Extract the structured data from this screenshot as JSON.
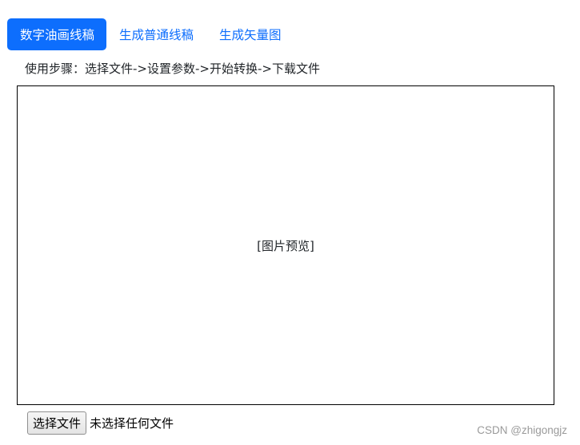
{
  "tabs": [
    {
      "label": "数字油画线稿",
      "active": true
    },
    {
      "label": "生成普通线稿",
      "active": false
    },
    {
      "label": "生成矢量图",
      "active": false
    }
  ],
  "instructions": "使用步骤：选择文件->设置参数->开始转换->下载文件",
  "preview": {
    "placeholder": "[图片预览]"
  },
  "file_input": {
    "button_label": "选择文件",
    "status": "未选择任何文件"
  },
  "watermark": "CSDN @zhigongjz",
  "colors": {
    "accent": "#0d6efd",
    "text": "#212529",
    "border": "#000000",
    "watermark": "#9a9a9a"
  }
}
